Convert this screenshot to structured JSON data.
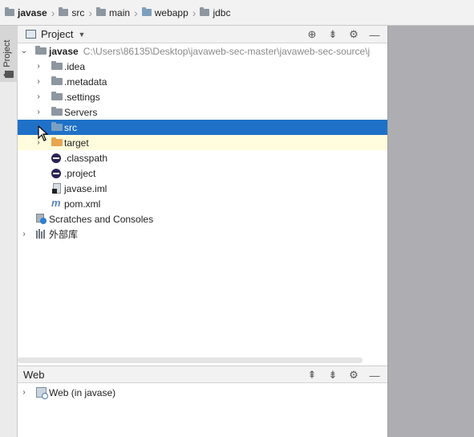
{
  "breadcrumb": [
    {
      "label": "javase",
      "icon": "folder-icon"
    },
    {
      "label": "src",
      "icon": "folder-icon"
    },
    {
      "label": "main",
      "icon": "folder-icon"
    },
    {
      "label": "webapp",
      "icon": "web-folder-icon"
    },
    {
      "label": "jdbc",
      "icon": "folder-icon"
    }
  ],
  "side_tab": {
    "label": "1: Project"
  },
  "project_panel": {
    "title": "Project",
    "tools": [
      "locate-icon",
      "collapse-icon",
      "gear-icon",
      "minimize-icon"
    ]
  },
  "tree": {
    "root": {
      "label": "javase",
      "path": "C:\\Users\\86135\\Desktop\\javaweb-sec-master\\javaweb-sec-source\\j"
    },
    "items": [
      {
        "label": ".idea",
        "icon": "folder-icon"
      },
      {
        "label": ".metadata",
        "icon": "folder-icon"
      },
      {
        "label": ".settings",
        "icon": "folder-icon"
      },
      {
        "label": "Servers",
        "icon": "folder-icon"
      },
      {
        "label": "src",
        "icon": "folder-icon",
        "selected": true
      },
      {
        "label": "target",
        "icon": "orange-folder-icon"
      },
      {
        "label": ".classpath",
        "icon": "eclipse-icon"
      },
      {
        "label": ".project",
        "icon": "eclipse-icon"
      },
      {
        "label": "javase.iml",
        "icon": "module-file-icon"
      },
      {
        "label": "pom.xml",
        "icon": "maven-icon"
      }
    ],
    "scratches": "Scratches and Consoles",
    "external_libs": "外部库"
  },
  "web_panel": {
    "title": "Web",
    "tools": [
      "expand-icon",
      "collapse-icon",
      "gear-icon",
      "minimize-icon"
    ],
    "item": "Web (in javase)"
  }
}
